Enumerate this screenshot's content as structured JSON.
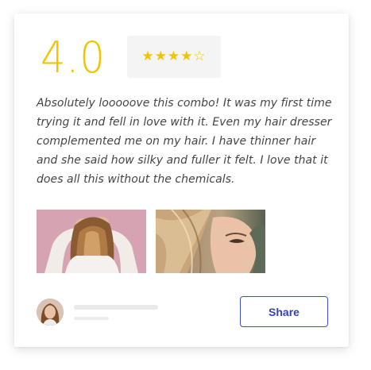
{
  "review": {
    "rating": "4.0",
    "stars": "★★★★☆",
    "rating_value": 4,
    "rating_max": 5,
    "text": "Absolutely looooove this combo! It was my first time trying it and fell in love with it. Even my hair dresser complemented me on my hair. I have thinner hair and she said how silky and fuller it felt. I love that it does all this without the chemicals."
  },
  "photos": [
    {
      "name": "review-photo-hair-back"
    },
    {
      "name": "review-photo-face-closeup"
    }
  ],
  "footer": {
    "share_label": "Share"
  },
  "colors": {
    "rating": "#f2c400",
    "stars_bg": "#f4f4f4",
    "text": "#444444",
    "share": "#3d4ec8",
    "skeleton": "#e9e9e9"
  }
}
